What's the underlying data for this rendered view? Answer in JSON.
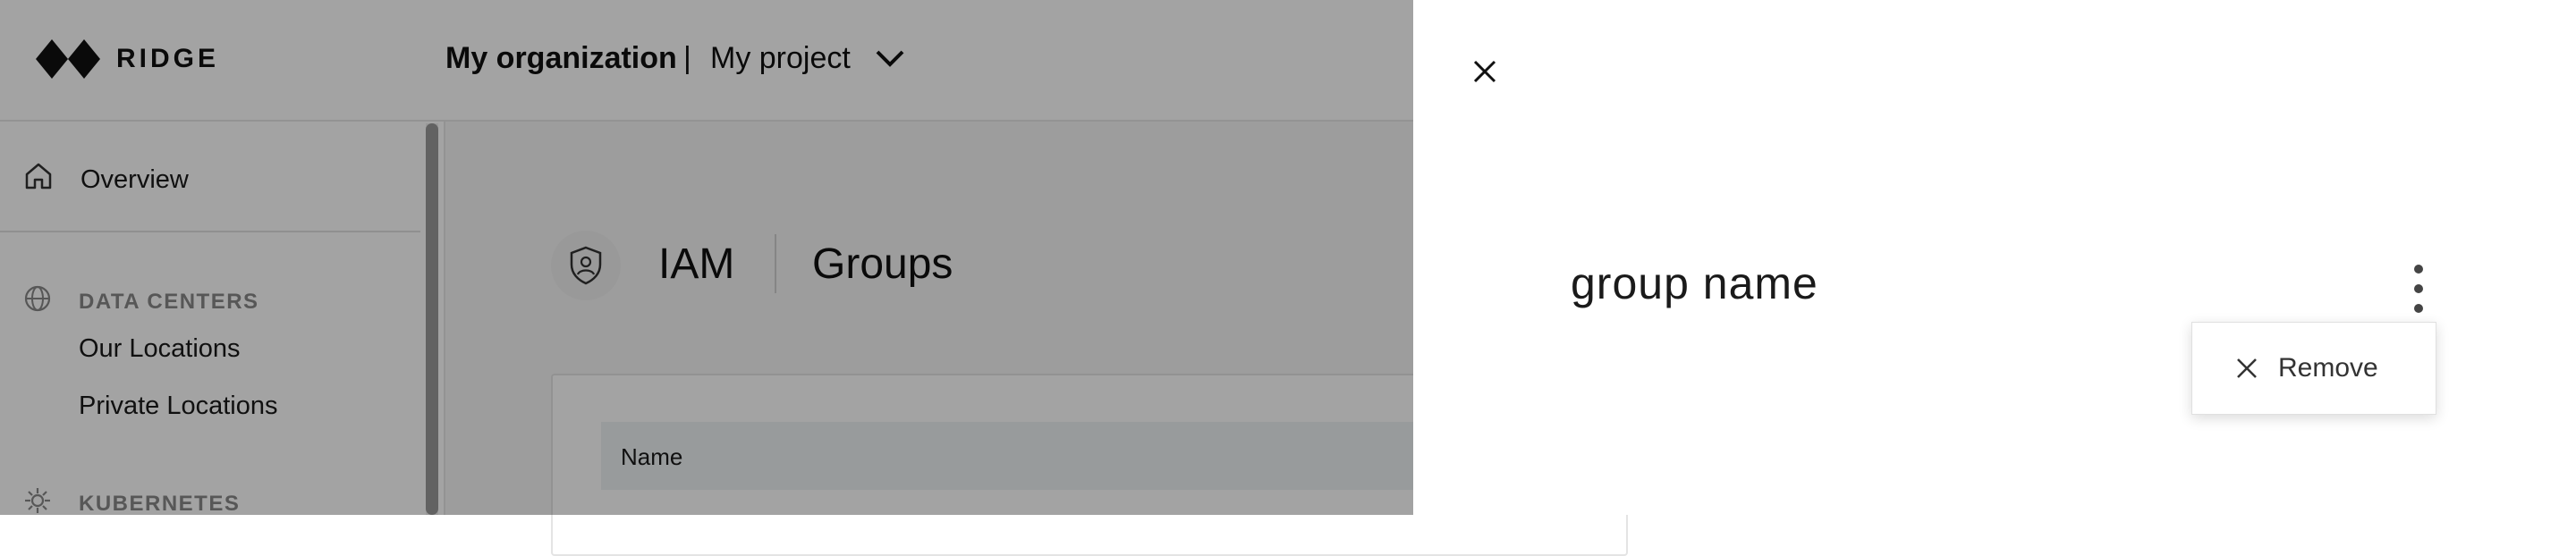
{
  "brand": {
    "name": "RIDGE"
  },
  "header": {
    "organization": "My organization",
    "separator": "|",
    "project": "My project"
  },
  "sidebar": {
    "overview": "Overview",
    "sections": [
      {
        "title": "DATA CENTERS",
        "items": [
          "Our Locations",
          "Private Locations"
        ]
      },
      {
        "title": "KUBERNETES",
        "items": []
      }
    ]
  },
  "main": {
    "section": "IAM",
    "page": "Groups",
    "table": {
      "columns": [
        "Name"
      ]
    }
  },
  "drawer": {
    "title": "group name",
    "menu": {
      "items": [
        {
          "label": "Remove",
          "icon": "close-icon"
        }
      ]
    }
  },
  "icons": {
    "logo": "ridge-logo-icon",
    "overview": "home-icon",
    "data_centers": "globe-icon",
    "kubernetes": "kubernetes-icon",
    "iam": "shield-user-icon",
    "close": "close-icon",
    "more": "kebab-icon",
    "project_dropdown": "chevron-down-icon"
  }
}
